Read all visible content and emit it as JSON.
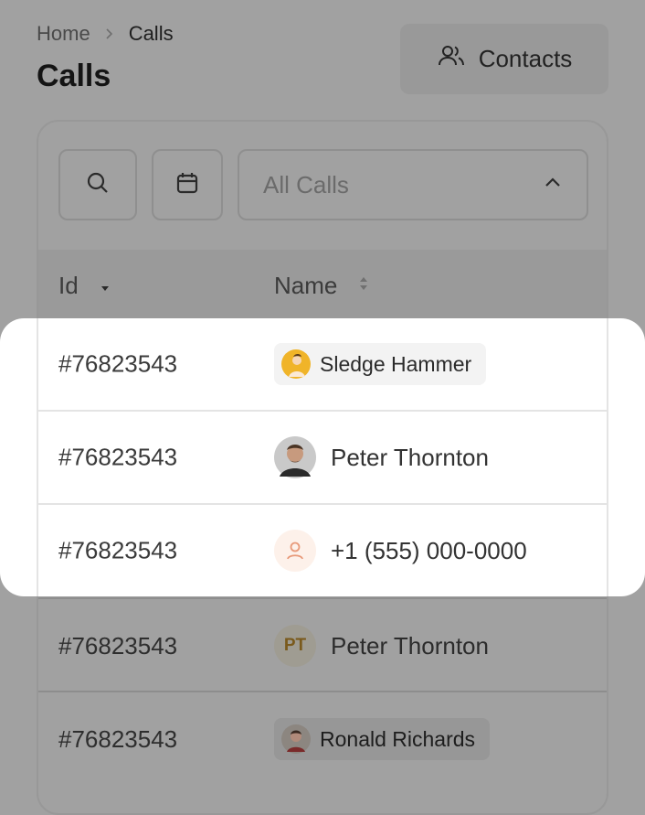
{
  "breadcrumb": {
    "home": "Home",
    "current": "Calls"
  },
  "page": {
    "title": "Calls"
  },
  "header": {
    "contacts_label": "Contacts"
  },
  "filters": {
    "select_value": "All Calls"
  },
  "table": {
    "columns": {
      "id": "Id",
      "name": "Name"
    },
    "rows": [
      {
        "id": "#76823543",
        "name": "Sledge Hammer"
      },
      {
        "id": "#76823543",
        "name": "Peter Thornton"
      },
      {
        "id": "#76823543",
        "name": "+1 (555) 000-0000"
      },
      {
        "id": "#76823543",
        "name": "Peter Thornton",
        "initials": "PT"
      },
      {
        "id": "#76823543",
        "name": "Ronald Richards"
      }
    ]
  },
  "colors": {
    "overlay": "#a1a1a1",
    "highlight": "#ffffff",
    "user_icon_accent": "#e89a7a",
    "initials_accent": "#c08a2a"
  },
  "icons": {
    "contacts": "users-icon",
    "search": "search-icon",
    "date": "calendar-icon",
    "select": "chevron-up-icon",
    "sort_id": "sort-desc-icon",
    "sort_name": "sort-icon",
    "breadcrumb_sep": "chevron-right-icon",
    "user_placeholder": "user-icon"
  }
}
